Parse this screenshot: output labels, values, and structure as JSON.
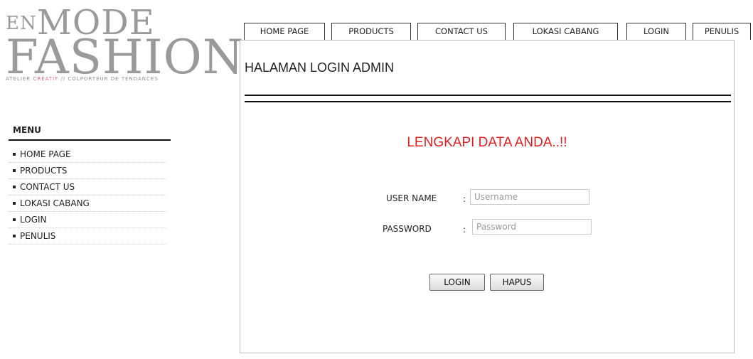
{
  "logo": {
    "prefix": "EN",
    "word1": "MODE",
    "word2": "FASHION",
    "tagline_part1": "ATELIER",
    "tagline_accent": "CRÉATIF",
    "tagline_part2": "// COLPORTEUR DE TENDANCES"
  },
  "sidebar": {
    "title": "MENU",
    "items": [
      "HOME PAGE",
      "PRODUCTS",
      "CONTACT US",
      "LOKASI CABANG",
      "LOGIN",
      "PENULIS"
    ]
  },
  "tabs": [
    "HOME PAGE",
    "PRODUCTS",
    "CONTACT US",
    "LOKASI CABANG",
    "LOGIN",
    "PENULIS"
  ],
  "main": {
    "title": "HALAMAN LOGIN ADMIN",
    "notice": "LENGKAPI DATA ANDA..!!",
    "username_label": "USER NAME",
    "password_label": "PASSWORD",
    "colon": ":",
    "username_placeholder": "Username",
    "password_placeholder": "Password",
    "login_button": "LOGIN",
    "reset_button": "HAPUS"
  },
  "colors": {
    "notice": "#e31e1e",
    "logo_gray": "#9a9a9a",
    "tagline_accent": "#e06b7c"
  }
}
